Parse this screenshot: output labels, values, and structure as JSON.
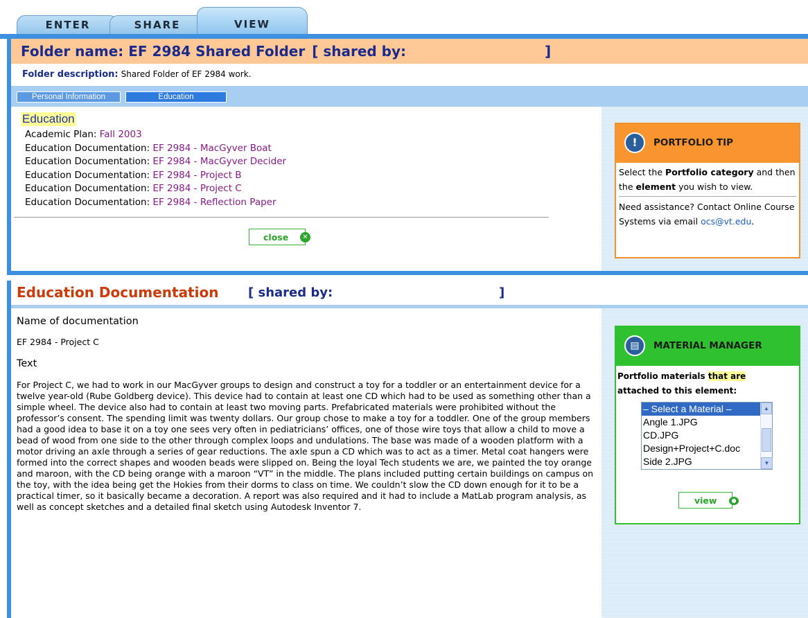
{
  "tabs": [
    {
      "label": "ENTER"
    },
    {
      "label": "SHARE"
    },
    {
      "label": "VIEW"
    }
  ],
  "folder": {
    "name": "Folder name: EF 2984 Shared Folder",
    "shared_by": "[ shared by:",
    "bracket_end": "]",
    "description_label": "Folder description:",
    "description": "Shared Folder of EF 2984 work."
  },
  "nav": {
    "items": [
      {
        "label": "Personal Information"
      },
      {
        "label": "Education"
      }
    ]
  },
  "education": {
    "title": "Education",
    "items": [
      {
        "label": "Academic Plan:",
        "link": "Fall 2003"
      },
      {
        "label": "Education Documentation:",
        "link": "EF 2984 - MacGyver Boat"
      },
      {
        "label": "Education Documentation:",
        "link": "EF 2984 - MacGyver Decider"
      },
      {
        "label": "Education Documentation:",
        "link": "EF 2984 - Project B"
      },
      {
        "label": "Education Documentation:",
        "link": "EF 2984 - Project C"
      },
      {
        "label": "Education Documentation:",
        "link": "EF 2984 - Reflection Paper"
      }
    ],
    "close_label": "close"
  },
  "portfolio_tip": {
    "title": "PORTFOLIO TIP",
    "text_1": "Select the ",
    "text_1b": "Portfolio category",
    "text_1c": " and then the ",
    "text_1d": "element",
    "text_1e": " you wish to view.",
    "text_2": "Need assistance?  Contact Online Course Systems via email ",
    "email": "ocs@vt.edu",
    "text_2_end": "."
  },
  "documentation": {
    "title": "Education Documentation",
    "shared_by": "[ shared by:",
    "bracket_end": "]",
    "name_heading": "Name of documentation",
    "name": "EF 2984 - Project C",
    "text_heading": "Text",
    "text": "For Project C, we had to work in our MacGyver groups to design and construct a toy for a toddler or an entertainment device for a twelve year-old (Rube Goldberg device). This device had to contain at least one CD which had to be used as something other than a simple wheel. The device also had to contain at least two moving parts. Prefabricated materials were prohibited without the professor’s consent. The spending limit was twenty dollars. Our group chose to make a toy for a toddler. One of the group members had a good idea to base it on a toy one sees very often in pediatricians’ offices, one of those wire toys that allow a child to move a bead of wood from one side to the other through complex loops and undulations. The base was made of a wooden platform with a motor driving an axle through a series of gear reductions. The axle spun a CD which was to act as a timer. Metal coat hangers were formed into the correct shapes and wooden beads were slipped on. Being the loyal Tech students we are, we painted the toy orange and maroon, with the CD being orange with a maroon “VT” in the middle. The plans included putting certain buildings on campus on the toy, with the idea being get the Hokies from their dorms to class on time. We couldn’t slow the CD down enough for it to be a practical timer, so it basically became a decoration. A report was also required and it had to include a MatLab program analysis, as well as concept sketches and a detailed final sketch using Autodesk Inventor 7."
  },
  "material_manager": {
    "title": "MATERIAL MANAGER",
    "desc_1": "Portfolio materials ",
    "desc_hl": "that are",
    "desc_2": "attached to this element:",
    "options": [
      {
        "label": "– Select a Material –"
      },
      {
        "label": "Angle 1.JPG"
      },
      {
        "label": "CD.JPG"
      },
      {
        "label": "Design+Project+C.doc"
      },
      {
        "label": "Side 2.JPG"
      }
    ],
    "view_label": "view"
  }
}
